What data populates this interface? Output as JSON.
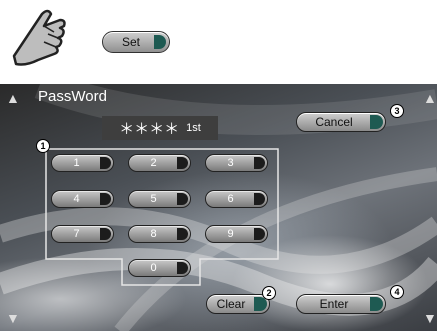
{
  "illustration": {
    "set_label": "Set"
  },
  "screen": {
    "title": "PassWord",
    "password_mask": "＊＊＊＊",
    "password_ordinal": "1st",
    "keys": [
      "1",
      "2",
      "3",
      "4",
      "5",
      "6",
      "7",
      "8",
      "9",
      "0"
    ],
    "cancel_label": "Cancel",
    "clear_label": "Clear",
    "enter_label": "Enter",
    "callouts": [
      "1",
      "2",
      "3",
      "4"
    ]
  },
  "icons": [
    "hand-pointer-icon",
    "arrow-up-icon",
    "arrow-down-icon"
  ]
}
